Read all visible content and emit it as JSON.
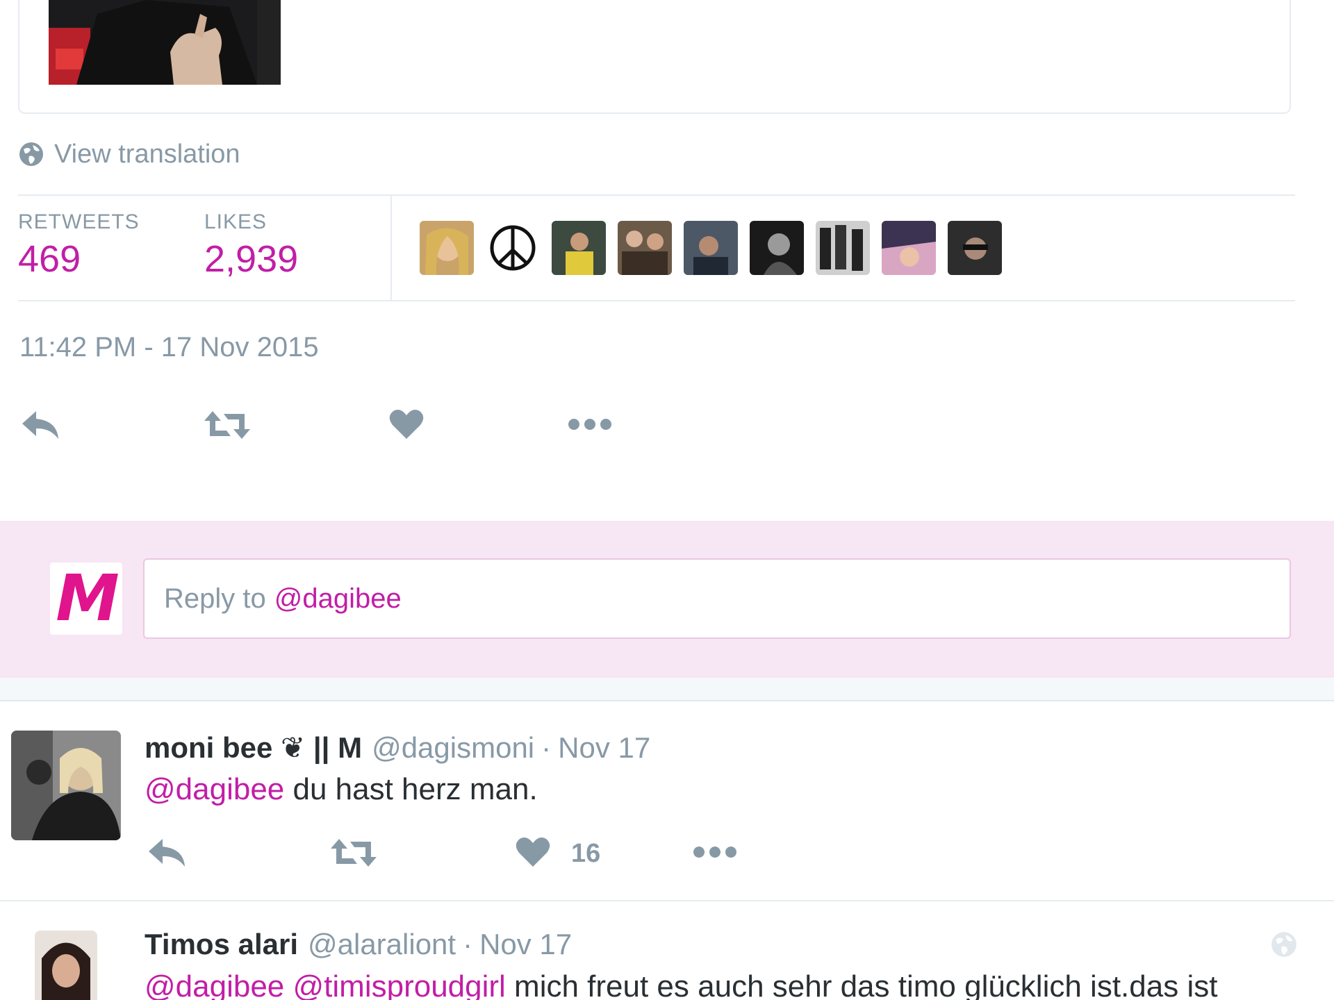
{
  "theme": {
    "accent": "#c11ea6",
    "muted": "#8899a6",
    "text": "#292f33",
    "reply_bg": "#f7e6f4",
    "logo_color": "#e0148c"
  },
  "main_tweet": {
    "translation_label": "View translation",
    "stats": {
      "retweets_label": "RETWEETS",
      "retweets_value": "469",
      "likes_label": "LIKES",
      "likes_value": "2,939"
    },
    "liker_avatar_count": 9,
    "timestamp": "11:42 PM - 17 Nov 2015",
    "actions": [
      "reply-icon",
      "retweet-icon",
      "heart-icon",
      "more-icon"
    ]
  },
  "reply_box": {
    "logo_letter": "M",
    "placeholder_prefix": "Reply to",
    "placeholder_mention": "@dagibee"
  },
  "replies": [
    {
      "name": "moni bee ❦ || M",
      "handle": "@dagismoni",
      "separator": "·",
      "time": "Nov 17",
      "mention": "@dagibee",
      "text": " du hast herz man.",
      "like_count": "16"
    },
    {
      "name": "Timos alari",
      "handle": "@alaraliont",
      "separator": "·",
      "time": "Nov 17",
      "mention1": "@dagibee",
      "mention2": "@timisproudgirl",
      "text": " mich freut es auch sehr das timo glücklich ist.das ist"
    }
  ]
}
